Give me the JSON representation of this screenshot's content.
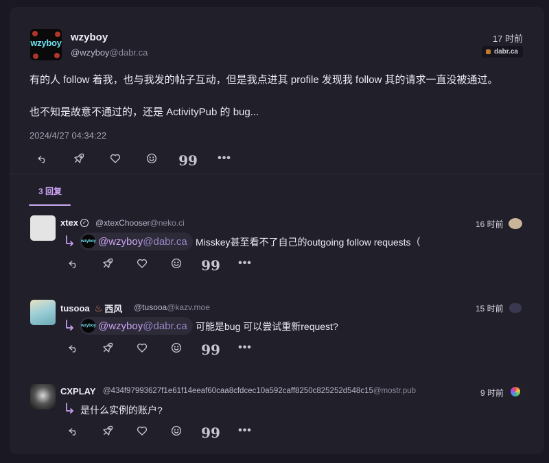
{
  "main_note": {
    "avatar_text": "wzyboy",
    "display_name": "wzyboy",
    "handle_user": "@wzyboy",
    "handle_host": "@dabr.ca",
    "time": "17 时前",
    "instance": "dabr.ca",
    "content_line1": "有的人 follow 着我，也与我发的帖子互动，但是我点进其 profile 发现我 follow 其的请求一直没被通过。",
    "content_line2": "也不知是故意不通过的，还是 ActivityPub 的 bug...",
    "date": "2024/4/27 04:34:22"
  },
  "actions": {
    "quote_glyph": "99",
    "more_glyph": "•••"
  },
  "tabs": {
    "replies_label": "3 回复"
  },
  "replies": [
    {
      "display_name": "xtex",
      "handle_user": "@xtexChooser",
      "handle_host": "@neko.ci",
      "time": "16 时前",
      "mention_user": "@wzyboy",
      "mention_host": "@dabr.ca",
      "text": "Misskey甚至看不了自己的outgoing follow requests（"
    },
    {
      "display_name": "tusooa",
      "name_suffix": "西风",
      "handle_user": "@tusooa",
      "handle_host": "@kazv.moe",
      "time": "15 时前",
      "mention_user": "@wzyboy",
      "mention_host": "@dabr.ca",
      "text": "可能是bug 可以尝试重新request?"
    },
    {
      "display_name": "CXPLAY",
      "handle_user": "@434f97993627f1e61f14eeaf60caa8cfdcec10a592caff8250c825252d548c15",
      "handle_host": "@mostr.pub",
      "time": "9 时前",
      "text": "是什么实例的账户?"
    }
  ],
  "mention_avatar_text": "wzyboy",
  "colors": {
    "background": "#1a1923",
    "card": "#211f2a",
    "accent": "#c9a3f2",
    "text": "#ecebf2",
    "muted": "#8d8a9c"
  }
}
